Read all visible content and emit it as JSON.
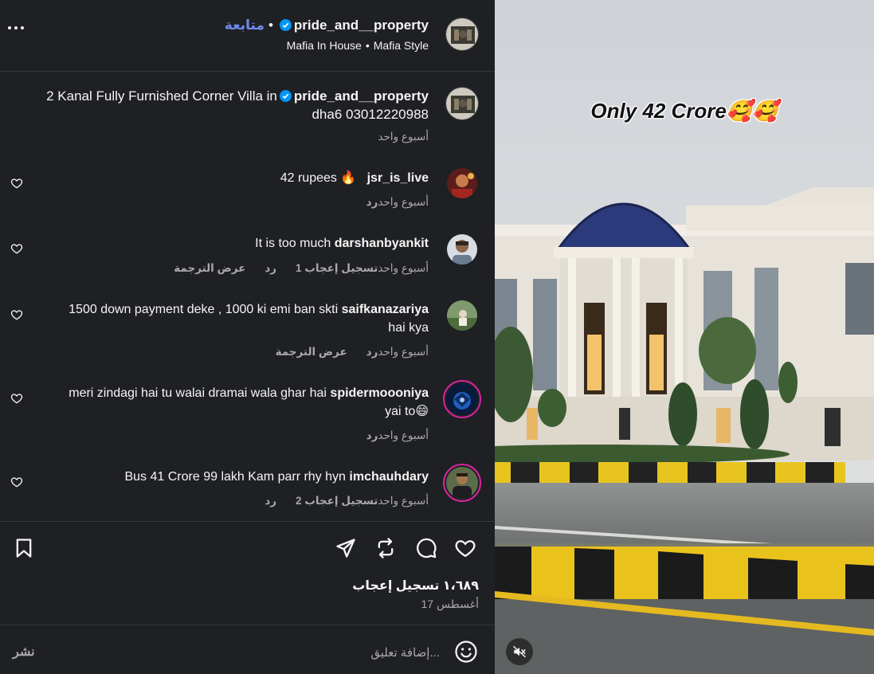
{
  "header": {
    "username": "pride_and__property",
    "follow_label": "متابعة",
    "audio_left": "Mafia In House",
    "audio_right": "Mafia Style"
  },
  "caption": {
    "username": "pride_and__property",
    "text_line1": "2 Kanal Fully Furnished Corner Villa in",
    "text_line2": "dha6 03012220988",
    "time": "أسبوع واحد"
  },
  "comments": [
    {
      "username": "jsr_is_live",
      "text": "42 rupees 🔥",
      "time": "أسبوع واحد",
      "likes": "",
      "reply": "رد",
      "translate": ""
    },
    {
      "username": "darshanbyankit",
      "text": "It is too much",
      "time": "أسبوع واحد",
      "likes": "1 تسجيل إعجاب",
      "reply": "رد",
      "translate": "عرض الترجمة"
    },
    {
      "username": "saifkanazariya",
      "text": "1500 down payment deke , 1000 ki emi ban skti",
      "text2": "hai kya",
      "time": "أسبوع واحد",
      "likes": "",
      "reply": "رد",
      "translate": "عرض الترجمة"
    },
    {
      "username": "spidermoooniya",
      "text": "meri zindagi hai tu walai dramai wala ghar hai",
      "text2": "yai to😄",
      "time": "أسبوع واحد",
      "likes": "",
      "reply": "رد",
      "translate": ""
    },
    {
      "username": "imchauhdary",
      "text": "Bus 41 Crore 99 lakh Kam parr rhy hyn",
      "time": "أسبوع واحد",
      "likes": "2 تسجيل إعجاب",
      "reply": "رد",
      "translate": ""
    }
  ],
  "stats": {
    "likes": "١،٦٨٩ تسجيل إعجاب",
    "date": "17 أغسطس"
  },
  "composer": {
    "placeholder": "إضافة تعليق...",
    "post_label": "نشر"
  },
  "video": {
    "overlay_text": "Only 42 Crore🥰🥰"
  },
  "colors": {
    "panel_bg": "#1f2023",
    "link_blue": "#6f8af0",
    "verified_blue": "#0095f6",
    "secondary_text": "#a8a8a8"
  }
}
